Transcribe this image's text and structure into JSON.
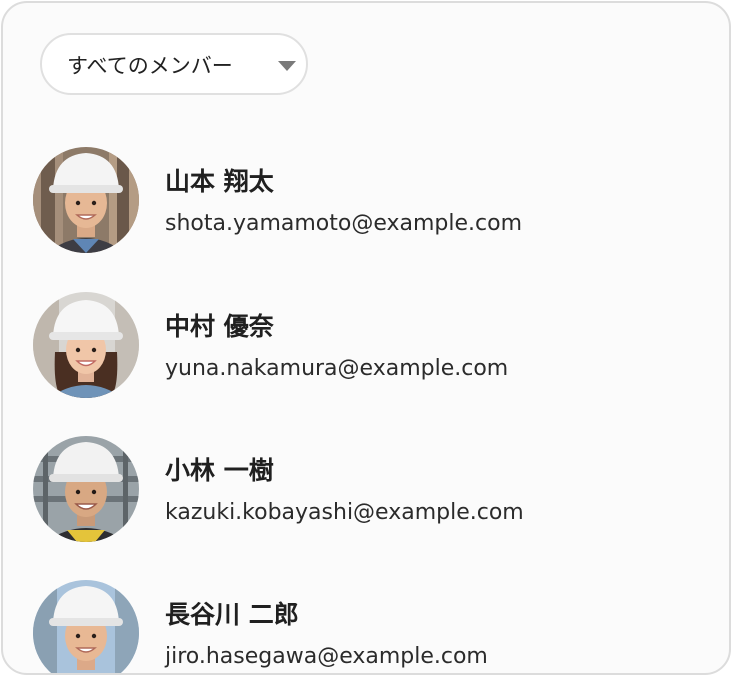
{
  "filter": {
    "selected": "すべてのメンバー",
    "icon": "chevron-down-icon"
  },
  "members": [
    {
      "name": "山本 翔太",
      "email": "shota.yamamoto@example.com"
    },
    {
      "name": "中村 優奈",
      "email": "yuna.nakamura@example.com"
    },
    {
      "name": "小林 一樹",
      "email": "kazuki.kobayashi@example.com"
    },
    {
      "name": "長谷川 二郎",
      "email": "jiro.hasegawa@example.com"
    }
  ],
  "colors": {
    "panel_bg": "#fbfbfb",
    "panel_border": "#dcdcdc",
    "helmet": "#f4f4f4",
    "text": "#202020"
  }
}
